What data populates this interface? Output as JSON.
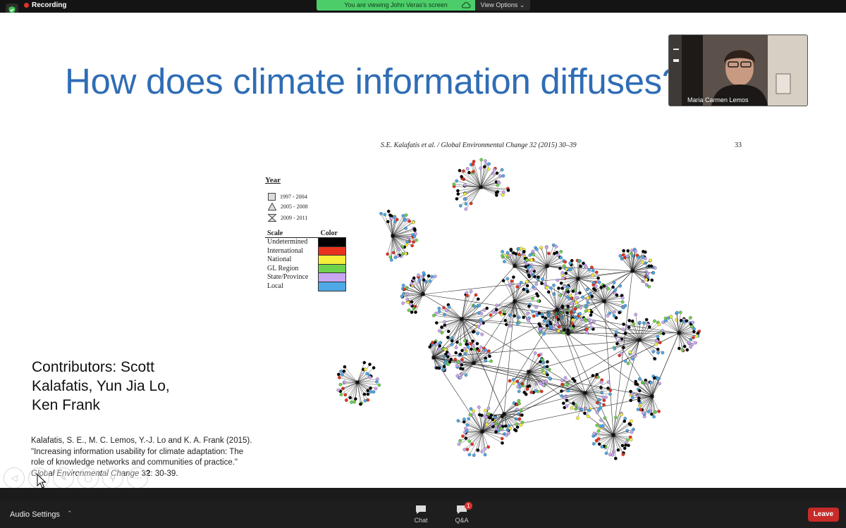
{
  "top_bar": {
    "recording_label": "Recording",
    "viewing_banner": "You are viewing John Veras's screen",
    "view_options_label": "View Options"
  },
  "slide": {
    "title": "How does climate information diffuses?",
    "figure_header": "S.E. Kalafatis et al. / Global Environmental Change 32 (2015) 30–39",
    "figure_page": "33",
    "legend": {
      "year_heading": "Year",
      "year_items": [
        "1997 - 2004",
        "2005 - 2008",
        "2009 - 2011"
      ],
      "scale_heading": "Scale",
      "color_heading": "Color",
      "scales": [
        {
          "label": "Undetermined",
          "color": "#000000"
        },
        {
          "label": "International",
          "color": "#e8321f"
        },
        {
          "label": "National",
          "color": "#f5ee3a"
        },
        {
          "label": "GL Region",
          "color": "#6fd24c"
        },
        {
          "label": "State/Province",
          "color": "#c9a6f2"
        },
        {
          "label": "Local",
          "color": "#4ea8e6"
        }
      ]
    },
    "contributors": [
      "Contributors: Scott",
      "Kalafatis, Yun Jia Lo,",
      "Ken Frank"
    ],
    "citation": {
      "text": "Kalafatis, S. E., M. C. Lemos, Y.-J. Lo and K. A. Frank (2015). \"Increasing information usability for climate adaptation: The role of knowledge networks and communities of practice.\"",
      "journal": "Global Environmental Change",
      "volume": "32",
      "pages": ": 30-39."
    }
  },
  "participant": {
    "name": "Maria Carmen Lemos"
  },
  "bottom_bar": {
    "audio_settings_label": "Audio Settings",
    "chat_label": "Chat",
    "qa_label": "Q&A",
    "qa_badge": "1",
    "leave_label": "Leave"
  }
}
